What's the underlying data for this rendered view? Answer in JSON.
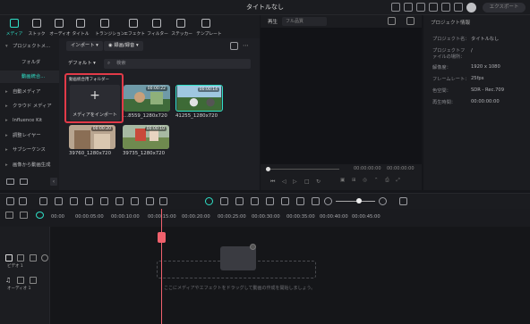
{
  "window": {
    "title": "タイトルなし",
    "export_label": "エクスポート"
  },
  "tabs": [
    {
      "label": "メディア"
    },
    {
      "label": "ストック"
    },
    {
      "label": "オーディオ"
    },
    {
      "label": "タイトル"
    },
    {
      "label": "トランジション"
    },
    {
      "label": "エフェクト"
    },
    {
      "label": "フィルター"
    },
    {
      "label": "ステッカー"
    },
    {
      "label": "テンプレート"
    }
  ],
  "sidebar": {
    "items": [
      {
        "label": "プロジェクトメ..."
      },
      {
        "label": "フォルダ"
      },
      {
        "label": "動画統合..."
      },
      {
        "label": "自動メディア"
      },
      {
        "label": "クラウド メディア"
      },
      {
        "label": "Influence Kit"
      },
      {
        "label": "調整レイヤー"
      },
      {
        "label": "サブシーケンス"
      },
      {
        "label": "画像から動画生成"
      }
    ]
  },
  "media": {
    "import_btn": "インポート",
    "record_btn": "録画/録音",
    "sort_btn": "デフォルト",
    "search_placeholder": "検索",
    "import_folder_label": "動画統合用フォルダー",
    "import_media_label": "メディアをインポート",
    "clips": [
      {
        "name": "...8559_1280x720",
        "duration": "00:00:22"
      },
      {
        "name": "41255_1280x720",
        "duration": "00:00:14"
      },
      {
        "name": "39760_1280x720",
        "duration": "00:00:20"
      },
      {
        "name": "39735_1280x720",
        "duration": "00:00:10"
      }
    ]
  },
  "preview": {
    "play_label": "再生",
    "quality_label": "フル品質",
    "timecode": "00:00:00:00"
  },
  "properties": {
    "header": "プロジェクト情報",
    "rows": [
      {
        "k": "プロジェクト名：",
        "v": "タイトルなし"
      },
      {
        "k": "プロジェクトファイルの場所：",
        "v": "/"
      },
      {
        "k": "解像度：",
        "v": "1920 x 1080"
      },
      {
        "k": "フレームレート：",
        "v": "25fps"
      },
      {
        "k": "色空間：",
        "v": "SDR - Rec.709"
      },
      {
        "k": "再生時間：",
        "v": "00:00:00:00"
      }
    ]
  },
  "timeline": {
    "ruler": [
      "00:00",
      "00:00:05:00",
      "00:00:10:00",
      "00:00:15:00",
      "00:00:20:00",
      "00:00:25:00",
      "00:00:30:00",
      "00:00:35:00",
      "00:00:40:00",
      "00:00:45:00"
    ],
    "video_track": "ビデオ 1",
    "audio_track": "オーディオ 1",
    "hint": "ここにメディアやエフェクトをドラッグして動画の作成を開始しましょう。"
  },
  "colors": {
    "accent": "#2fe0c7",
    "highlight": "#e23a48",
    "playhead": "#f0616d"
  }
}
